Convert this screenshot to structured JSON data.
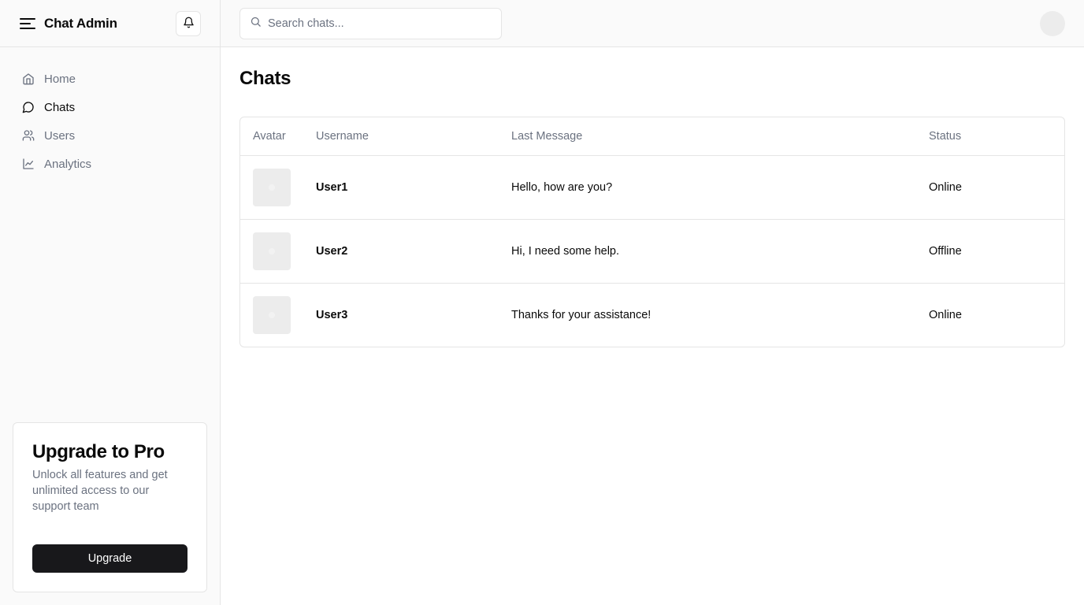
{
  "app": {
    "title": "Chat Admin"
  },
  "icons": {
    "menu": "menu-icon",
    "notifications": "bell-icon",
    "search": "search-icon",
    "home": "home-icon",
    "chats": "message-circle-icon",
    "users": "users-icon",
    "analytics": "line-chart-icon"
  },
  "sidebar": {
    "items": [
      {
        "label": "Home",
        "active": false
      },
      {
        "label": "Chats",
        "active": true
      },
      {
        "label": "Users",
        "active": false
      },
      {
        "label": "Analytics",
        "active": false
      }
    ]
  },
  "promo": {
    "title": "Upgrade to Pro",
    "description": "Unlock all features and get unlimited access to our support team",
    "button_label": "Upgrade"
  },
  "search": {
    "placeholder": "Search chats...",
    "value": ""
  },
  "page": {
    "title": "Chats"
  },
  "table": {
    "headers": [
      "Avatar",
      "Username",
      "Last Message",
      "Status"
    ],
    "rows": [
      {
        "username": "User1",
        "last_message": "Hello, how are you?",
        "status": "Online"
      },
      {
        "username": "User2",
        "last_message": "Hi, I need some help.",
        "status": "Offline"
      },
      {
        "username": "User3",
        "last_message": "Thanks for your assistance!",
        "status": "Online"
      }
    ]
  },
  "colors": {
    "primary_button": "#18181b",
    "muted_text": "#6b7280",
    "border": "#e5e5e5",
    "sidebar_bg": "#fafafa"
  }
}
